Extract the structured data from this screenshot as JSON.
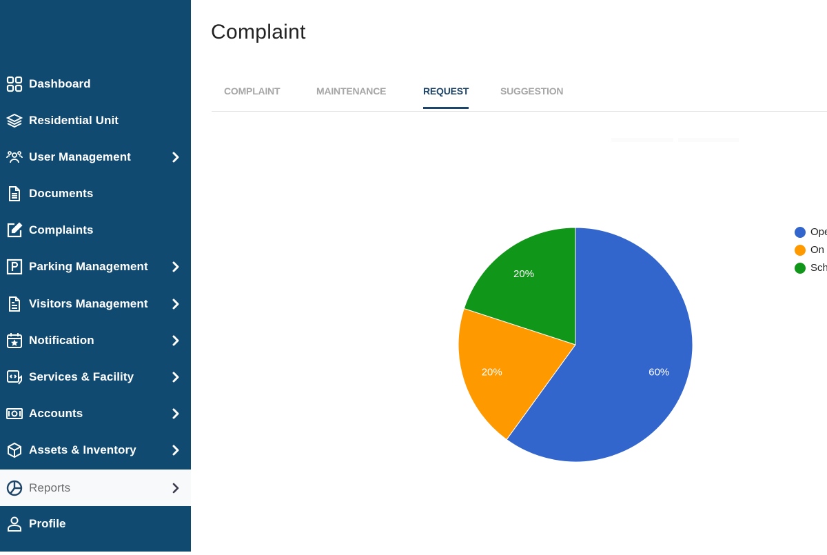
{
  "sidebar": {
    "items": [
      {
        "label": "Dashboard",
        "icon": "grid-icon",
        "has_submenu": false,
        "active": false
      },
      {
        "label": "Residential Unit",
        "icon": "layers-icon",
        "has_submenu": false,
        "active": false
      },
      {
        "label": "User Management",
        "icon": "users-icon",
        "has_submenu": true,
        "active": false
      },
      {
        "label": "Documents",
        "icon": "document-icon",
        "has_submenu": false,
        "active": false
      },
      {
        "label": "Complaints",
        "icon": "edit-icon",
        "has_submenu": false,
        "active": false
      },
      {
        "label": "Parking Management",
        "icon": "parking-icon",
        "has_submenu": true,
        "active": false
      },
      {
        "label": "Visitors Management",
        "icon": "visitor-document-icon",
        "has_submenu": true,
        "active": false
      },
      {
        "label": "Notification",
        "icon": "calendar-star-icon",
        "has_submenu": true,
        "active": false
      },
      {
        "label": "Services & Facility",
        "icon": "services-icon",
        "has_submenu": true,
        "active": false
      },
      {
        "label": "Accounts",
        "icon": "money-icon",
        "has_submenu": true,
        "active": false
      },
      {
        "label": "Assets & Inventory",
        "icon": "box-icon",
        "has_submenu": true,
        "active": false
      },
      {
        "label": "Reports",
        "icon": "pie-chart-icon",
        "has_submenu": true,
        "active": true
      },
      {
        "label": "Profile",
        "icon": "user-icon",
        "has_submenu": false,
        "active": false
      }
    ]
  },
  "main": {
    "title": "Complaint",
    "tabs": [
      {
        "label": "COMPLAINT",
        "active": false
      },
      {
        "label": "MAINTENANCE",
        "active": false
      },
      {
        "label": "REQUEST",
        "active": true
      },
      {
        "label": "SUGGESTION",
        "active": false
      }
    ]
  },
  "colors": {
    "sidebar_bg": "#114a70",
    "accent": "#1e4468"
  },
  "chart_data": {
    "type": "pie",
    "title": "",
    "start_angle": "12 o'clock, clockwise",
    "slices": [
      {
        "label": "Ope",
        "value": 60,
        "display": "60%",
        "color": "#3366cc"
      },
      {
        "label": "On",
        "value": 20,
        "display": "20%",
        "color": "#ff9900"
      },
      {
        "label": "Sch",
        "value": 20,
        "display": "20%",
        "color": "#109618"
      }
    ],
    "legend_position": "right",
    "legend_note": "legend labels are truncated at the screen edge"
  }
}
